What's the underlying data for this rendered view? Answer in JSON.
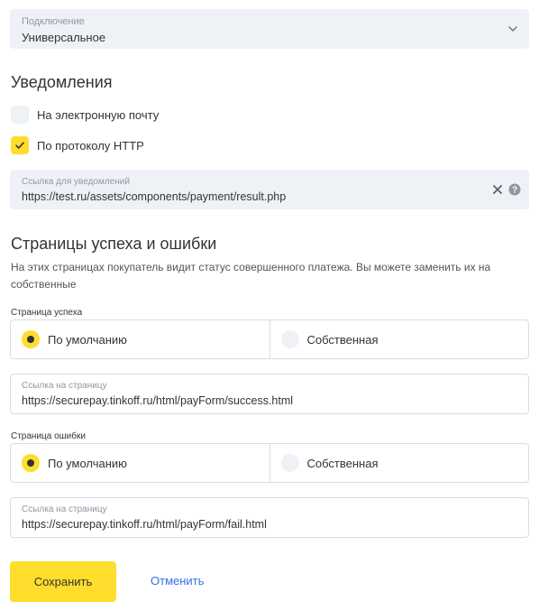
{
  "connection": {
    "label": "Подключение",
    "value": "Универсальное",
    "icon": "chevron-down-icon"
  },
  "notifications": {
    "title": "Уведомления",
    "email_label": "На электронную почту",
    "email_checked": false,
    "http_label": "По протоколу HTTP",
    "http_checked": true,
    "url_label": "Ссылка для уведомлений",
    "url_value": "https://test.ru/assets/components/payment/result.php"
  },
  "pages": {
    "title": "Страницы успеха и ошибки",
    "description": "На этих страницах покупатель видит статус совершенного платежа. Вы можете заменить их на собственные",
    "success": {
      "label": "Страница успеха",
      "option_default": "По умолчанию",
      "option_custom": "Собственная",
      "selected": "default",
      "link_label": "Ссылка на страницу",
      "link_value": "https://securepay.tinkoff.ru/html/payForm/success.html"
    },
    "error": {
      "label": "Страница ошибки",
      "option_default": "По умолчанию",
      "option_custom": "Собственная",
      "selected": "default",
      "link_label": "Ссылка на страницу",
      "link_value": "https://securepay.tinkoff.ru/html/payForm/fail.html"
    }
  },
  "actions": {
    "save_label": "Сохранить",
    "cancel_label": "Отменить"
  },
  "colors": {
    "accent": "#ffdd2d",
    "link": "#336fee",
    "field_bg": "#eef2f7"
  }
}
